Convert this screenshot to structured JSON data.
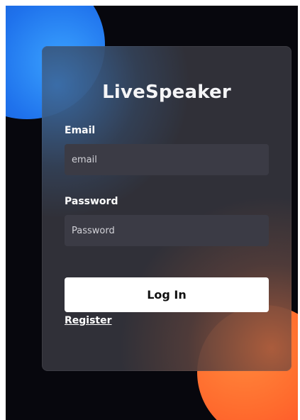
{
  "app": {
    "title": "LiveSpeaker"
  },
  "form": {
    "email_label": "Email",
    "email_placeholder": "email",
    "email_value": "",
    "password_label": "Password",
    "password_placeholder": "Password",
    "password_value": "",
    "login_label": "Log In",
    "register_label": "Register"
  },
  "colors": {
    "background": "#07070d",
    "card": "#34343c",
    "input": "#3b3b45",
    "accent_blue": "#3aa2ff",
    "accent_orange": "#ff6a2d",
    "button": "#ffffff"
  }
}
